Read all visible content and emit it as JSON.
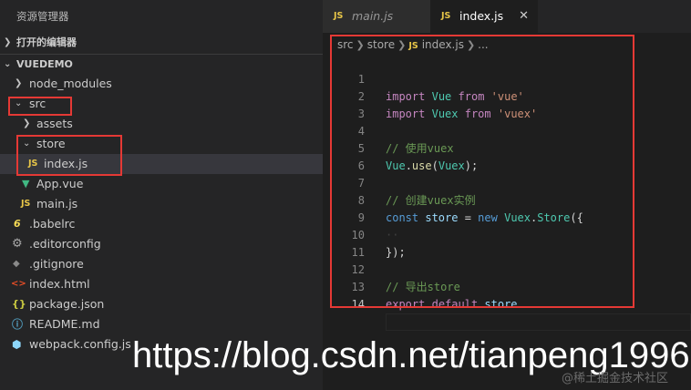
{
  "explorer": {
    "title": "资源管理器",
    "open_editors": "打开的编辑器",
    "project": "VUEDEMO",
    "tree": [
      {
        "label": "node_modules",
        "type": "folder",
        "expanded": false
      },
      {
        "label": "src",
        "type": "folder",
        "expanded": true
      },
      {
        "label": "assets",
        "type": "folder",
        "expanded": false
      },
      {
        "label": "store",
        "type": "folder",
        "expanded": true
      },
      {
        "label": "index.js",
        "type": "js",
        "icon_text": "JS"
      },
      {
        "label": "App.vue",
        "type": "vue",
        "icon_text": "▼"
      },
      {
        "label": "main.js",
        "type": "js",
        "icon_text": "JS"
      },
      {
        "label": ".babelrc",
        "type": "babel",
        "icon_text": "6"
      },
      {
        "label": ".editorconfig",
        "type": "gear",
        "icon_text": "⚙"
      },
      {
        "label": ".gitignore",
        "type": "git",
        "icon_text": "◆"
      },
      {
        "label": "index.html",
        "type": "html",
        "icon_text": "<>"
      },
      {
        "label": "package.json",
        "type": "json",
        "icon_text": "{}"
      },
      {
        "label": "README.md",
        "type": "info",
        "icon_text": "ⓘ"
      },
      {
        "label": "webpack.config.js",
        "type": "webpack",
        "icon_text": "⬢"
      }
    ]
  },
  "tabs": [
    {
      "label": "main.js",
      "badge": "JS"
    },
    {
      "label": "index.js",
      "badge": "JS",
      "close": "✕"
    }
  ],
  "breadcrumb": {
    "parts": [
      "src",
      "store",
      "index.js",
      "..."
    ],
    "badge": "JS"
  },
  "code": {
    "line_numbers": [
      "1",
      "2",
      "3",
      "4",
      "5",
      "6",
      "7",
      "8",
      "9",
      "10",
      "11",
      "12",
      "13",
      "14"
    ],
    "l1": {
      "import": "import",
      "name": "Vue",
      "from": "from",
      "src": "'vue'"
    },
    "l2": {
      "import": "import",
      "name": "Vuex",
      "from": "from",
      "src": "'vuex'"
    },
    "l4": "// 使用vuex",
    "l5": {
      "obj": "Vue",
      "dot": ".",
      "method": "use",
      "open": "(",
      "arg": "Vuex",
      "close": ");"
    },
    "l7": "// 创建vuex实例",
    "l8": {
      "const": "const",
      "name": "store",
      "eq": " = ",
      "new": "new",
      "cls": "Vuex",
      "dot": ".",
      "ctor": "Store",
      "open": "({"
    },
    "l9": "··",
    "l10": "});",
    "l12": "// 导出store",
    "l13": {
      "export": "export",
      "default": "default",
      "name": "store"
    }
  },
  "watermark": {
    "url": "https://blog.csdn.net/tianpeng1996",
    "sub": "@稀土掘金技术社区"
  },
  "colors": {
    "highlight_box": "#e53935",
    "js_badge": "#e8c648",
    "sidebar_bg": "#252526",
    "editor_bg": "#1e1e1e"
  }
}
